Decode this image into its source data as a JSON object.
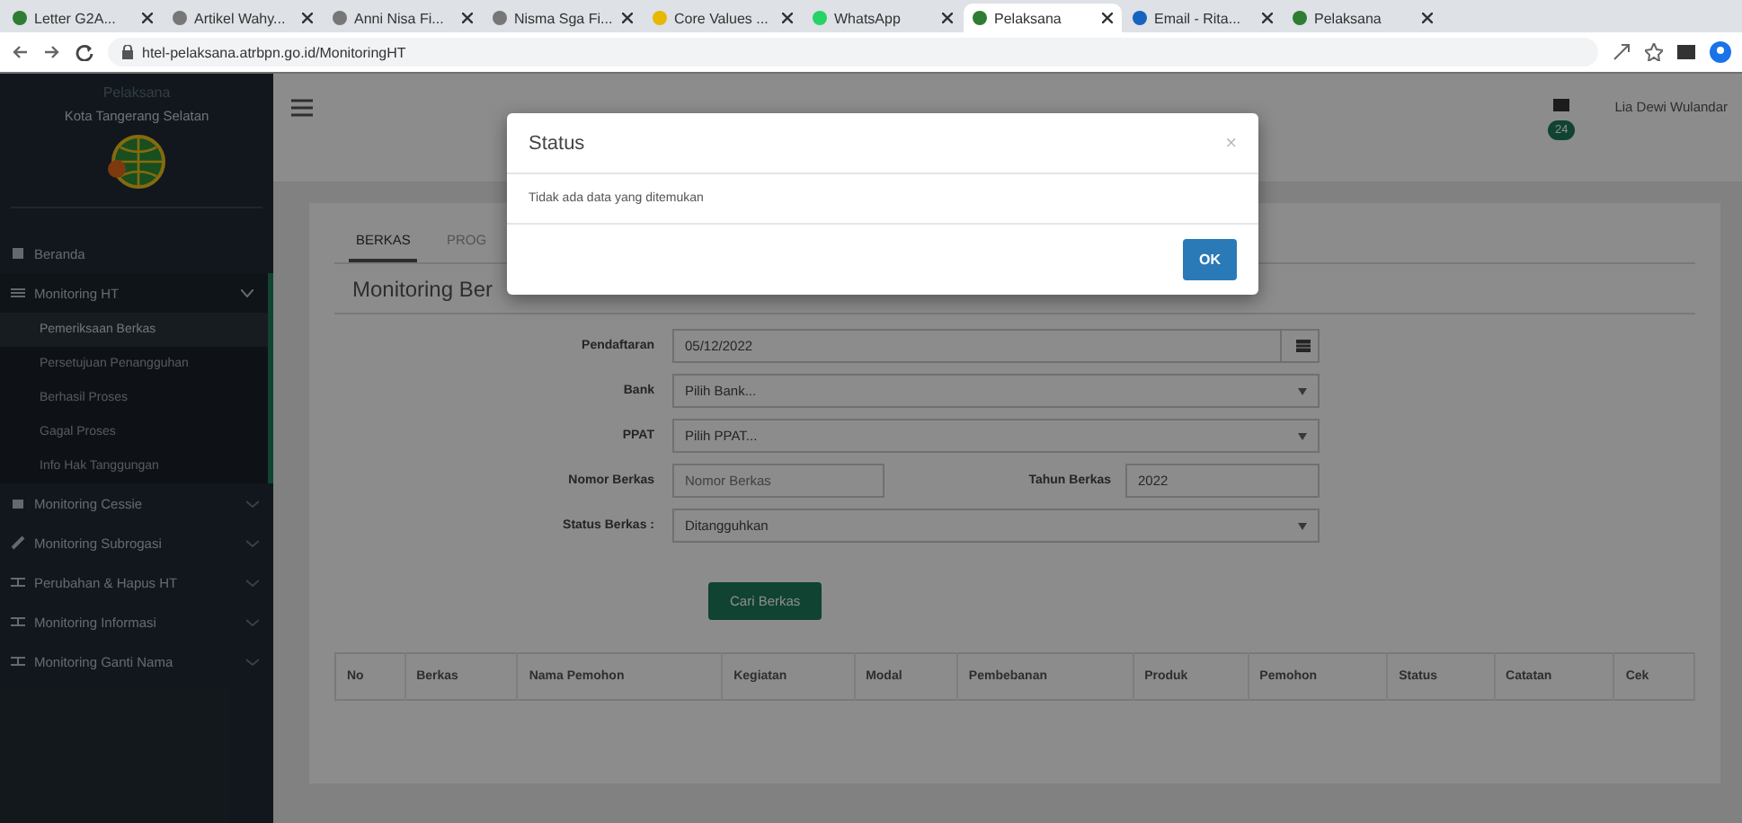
{
  "browser": {
    "tabs": [
      {
        "label": "Letter G2A...",
        "selected": false
      },
      {
        "label": "Artikel Wahy...",
        "selected": false
      },
      {
        "label": "Anni Nisa Fi...",
        "selected": false
      },
      {
        "label": "Nisma Sga Fi...",
        "selected": false
      },
      {
        "label": "Core Values ...",
        "selected": false
      },
      {
        "label": "WhatsApp",
        "selected": false
      },
      {
        "label": "Pelaksana",
        "selected": true
      },
      {
        "label": "Email - Rita...",
        "selected": false
      },
      {
        "label": "Pelaksana",
        "selected": false
      }
    ],
    "address": "htel-pelaksana.atrbpn.go.id/MonitoringHT"
  },
  "sidebar": {
    "app_name": "Pelaksana",
    "office": "Kota Tangerang Selatan",
    "items": [
      {
        "label": "Beranda",
        "expanded": false
      },
      {
        "label": "Monitoring HT",
        "expanded": true,
        "children": [
          {
            "label": "Pemeriksaan Berkas",
            "selected": true
          },
          {
            "label": "Persetujuan Penangguhan",
            "selected": false
          },
          {
            "label": "Berhasil Proses",
            "selected": false
          },
          {
            "label": "Gagal Proses",
            "selected": false
          },
          {
            "label": "Info Hak Tanggungan",
            "selected": false
          }
        ]
      },
      {
        "label": "Monitoring Cessie",
        "expanded": false
      },
      {
        "label": "Monitoring Subrogasi",
        "expanded": false
      },
      {
        "label": "Perubahan & Hapus HT",
        "expanded": false
      },
      {
        "label": "Monitoring Informasi",
        "expanded": false
      },
      {
        "label": "Monitoring Ganti Nama",
        "expanded": false
      }
    ]
  },
  "header": {
    "notification_count": "24",
    "user": "Lia Dewi Wulandar"
  },
  "tabs": [
    {
      "label": "BERKAS",
      "selected": true
    },
    {
      "label": "PROG",
      "selected": false
    }
  ],
  "panel_title": "Monitoring Ber",
  "form": {
    "fields": [
      {
        "kind": "date",
        "label": "Pendaftaran",
        "value": "05/12/2022"
      },
      {
        "kind": "select",
        "label": "Bank",
        "value": "Pilih Bank..."
      },
      {
        "kind": "select",
        "label": "PPAT",
        "value": "Pilih PPAT..."
      },
      {
        "kind": "pair",
        "label": "Nomor Berkas",
        "placeholder": "Nomor Berkas",
        "label_2": "Tahun Berkas",
        "value_2": "2022"
      },
      {
        "kind": "select",
        "label": "Status Berkas :",
        "value": "Ditangguhkan"
      }
    ],
    "button": "Cari Berkas"
  },
  "table": {
    "columns": [
      "No",
      "Berkas",
      "Nama Pemohon",
      "Kegiatan",
      "Modal",
      "Pembebanan",
      "Produk",
      "Pemohon",
      "Status",
      "Catatan",
      "Cek"
    ]
  },
  "modal": {
    "title": "Status",
    "close": "×",
    "message": "Tidak ada data yang ditemukan",
    "button": "OK"
  }
}
